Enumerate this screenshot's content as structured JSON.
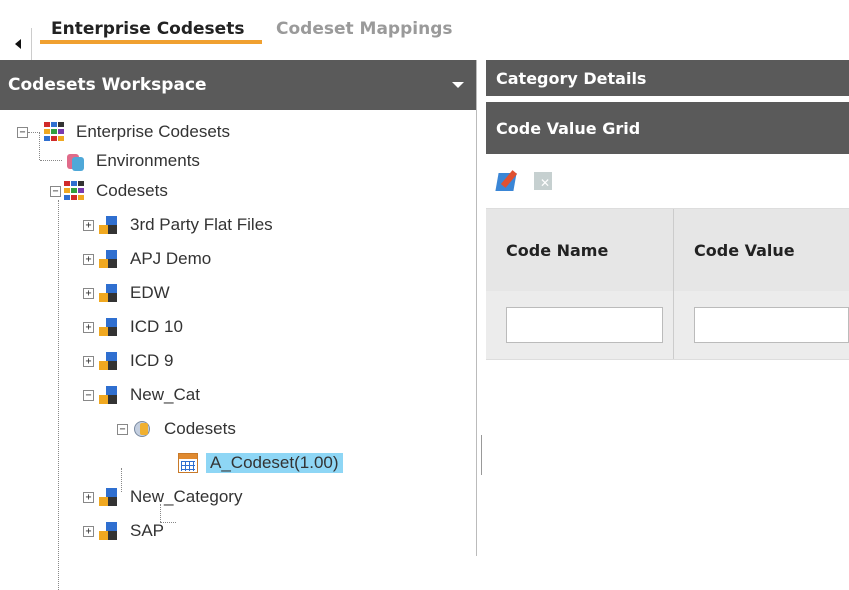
{
  "tabs": [
    {
      "label": "Enterprise Codesets",
      "active": true
    },
    {
      "label": "Codeset Mappings",
      "active": false
    }
  ],
  "workspace": {
    "title": "Codesets Workspace",
    "tree": {
      "root": "Enterprise Codesets",
      "environments": "Environments",
      "codesets": "Codesets",
      "categories": [
        {
          "label": "3rd Party Flat Files",
          "expanded": false
        },
        {
          "label": "APJ Demo",
          "expanded": false
        },
        {
          "label": "EDW",
          "expanded": false
        },
        {
          "label": "ICD 10",
          "expanded": false
        },
        {
          "label": "ICD 9",
          "expanded": false
        },
        {
          "label": "New_Cat",
          "expanded": true
        },
        {
          "label": "New_Category",
          "expanded": false
        },
        {
          "label": "SAP",
          "expanded": false
        }
      ],
      "new_cat_child": "Codesets",
      "selected_codeset": "A_Codeset(1.00)"
    }
  },
  "right": {
    "category_details": "Category Details",
    "code_value_grid": "Code Value Grid",
    "columns": [
      "Code Name",
      "Code Value"
    ],
    "filters": [
      "",
      ""
    ]
  },
  "colors": {
    "accent": "#f0a030",
    "header_bg": "#5a5a5a",
    "selection": "#8ed6f5"
  }
}
